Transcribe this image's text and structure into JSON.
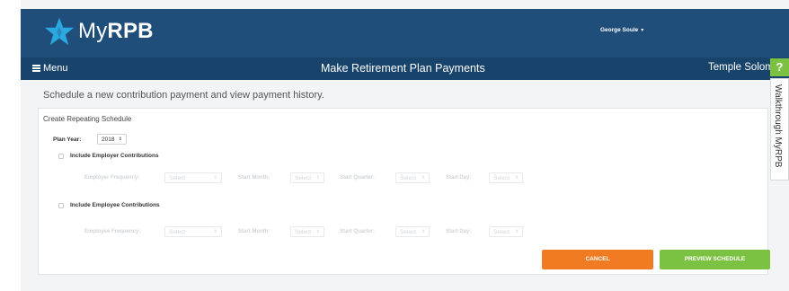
{
  "header": {
    "logo_prefix": "My",
    "logo_bold": "RPB",
    "user_name": "George Soule"
  },
  "nav": {
    "menu_label": "Menu",
    "page_title": "Make Retirement Plan Payments",
    "organization": "Temple Solom"
  },
  "side_tabs": {
    "help_label": "?",
    "walkthrough_label": "Walkthrough MyRPB"
  },
  "subtitle": "Schedule a new contribution payment and view payment history.",
  "panel": {
    "title": "Create Repeating Schedule",
    "plan_year_label": "Plan Year:",
    "plan_year_value": "2018",
    "employer": {
      "checkbox_label": "Include Employer Contributions",
      "frequency_label": "Employer Frequency:",
      "start_month_label": "Start Month:",
      "start_quarter_label": "Start Quarter:",
      "start_day_label": "Start Day:",
      "select_placeholder": "Select"
    },
    "employee": {
      "checkbox_label": "Include Employee Contributions",
      "frequency_label": "Employee Frequency:",
      "start_month_label": "Start Month:",
      "start_quarter_label": "Start Quarter:",
      "start_day_label": "Start Day:",
      "select_placeholder": "Select"
    }
  },
  "buttons": {
    "cancel_label": "CANCEL",
    "preview_label": "PREVIEW SCHEDULE"
  },
  "colors": {
    "header_bg": "#1f4e7a",
    "nav_bg": "#18436b",
    "cancel": "#f07b22",
    "preview": "#7bc142",
    "logo_star": "#2aa8e0"
  },
  "icons": {
    "logo": "star-logo-icon",
    "menu": "hamburger-icon",
    "user_caret": "caret-down-icon",
    "select_arrow": "up-down-arrows-icon"
  }
}
